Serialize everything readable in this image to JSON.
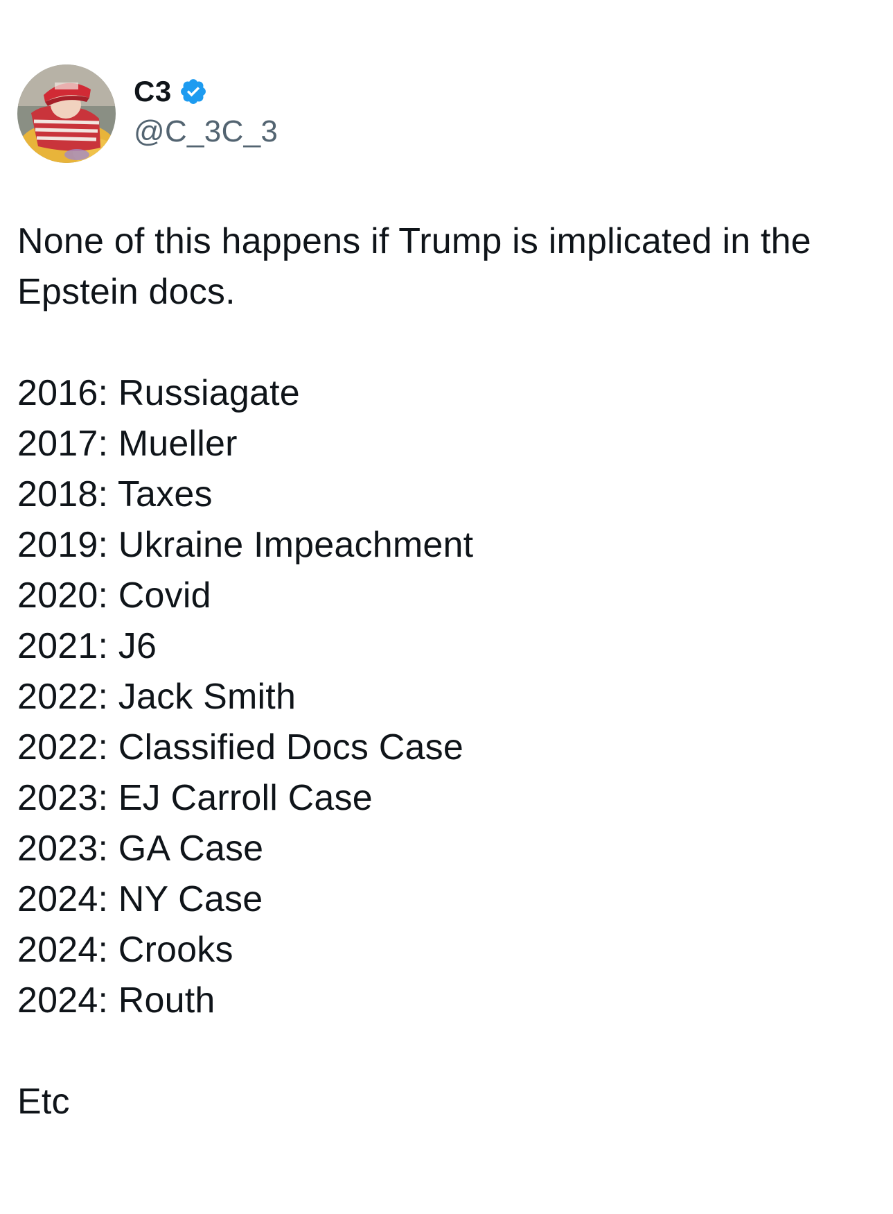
{
  "author": {
    "display_name": "C3",
    "handle": "@C_3C_3",
    "verified": true,
    "avatar_icon": "profile-photo",
    "verified_icon": "verified-badge-icon"
  },
  "tweet": {
    "intro": "None of this happens if Trump is implicated in the Epstein docs.",
    "timeline": [
      "2016: Russiagate",
      "2017: Mueller",
      "2018: Taxes",
      "2019: Ukraine Impeachment",
      "2020: Covid",
      "2021: J6",
      "2022: Jack Smith",
      "2022: Classified Docs Case",
      "2023: EJ Carroll Case",
      "2023: GA Case",
      "2024: NY Case",
      "2024: Crooks",
      "2024: Routh"
    ],
    "outro": "Etc"
  },
  "colors": {
    "text": "#0f1419",
    "secondary_text": "#536471",
    "verified_blue": "#1d9bf0",
    "background": "#ffffff"
  }
}
